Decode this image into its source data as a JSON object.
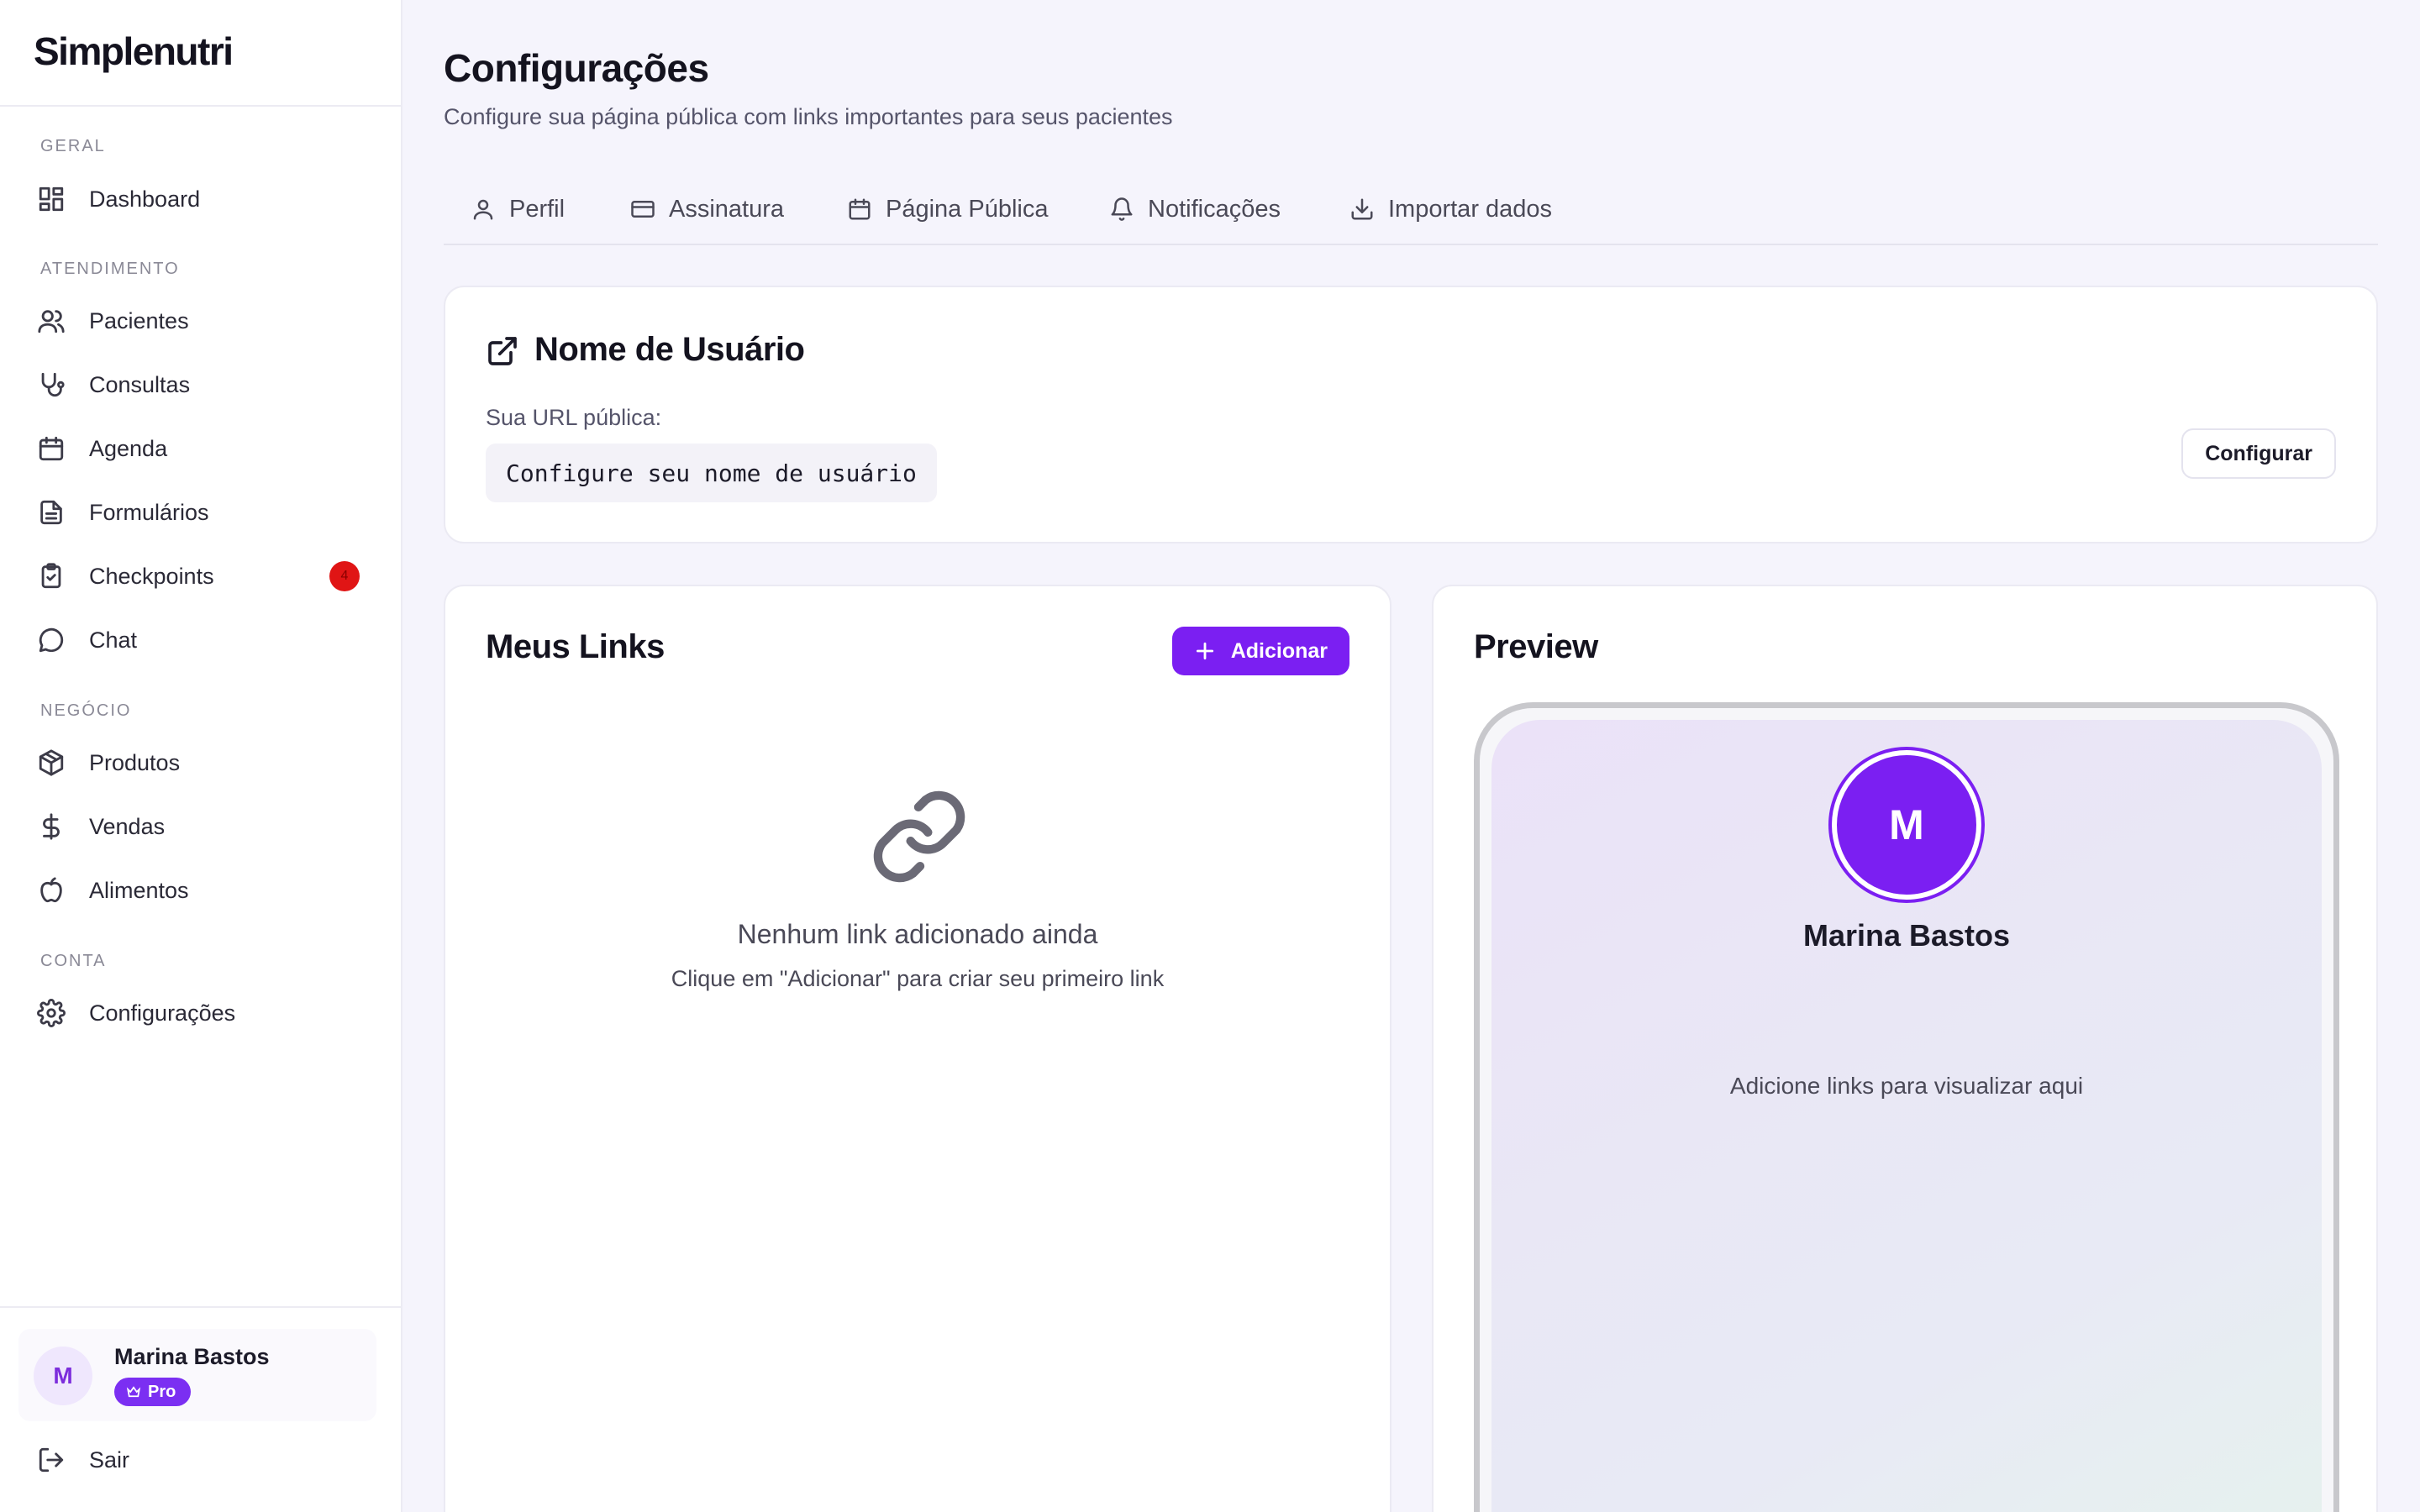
{
  "app": {
    "logo": "Simplenutri"
  },
  "sidebar": {
    "sections": {
      "geral": "GERAL",
      "atendimento": "ATENDIMENTO",
      "negocio": "NEGÓCIO",
      "conta": "CONTA"
    },
    "items": {
      "dashboard": "Dashboard",
      "pacientes": "Pacientes",
      "consultas": "Consultas",
      "agenda": "Agenda",
      "formularios": "Formulários",
      "checkpoints": "Checkpoints",
      "chat": "Chat",
      "produtos": "Produtos",
      "vendas": "Vendas",
      "alimentos": "Alimentos",
      "configuracoes": "Configurações"
    },
    "checkpoints_badge": "4",
    "user": {
      "initial": "M",
      "name": "Marina Bastos",
      "plan": "Pro"
    },
    "logout": "Sair"
  },
  "header": {
    "title": "Configurações",
    "subtitle": "Configure sua página pública com links importantes para seus pacientes"
  },
  "tabs": {
    "perfil": "Perfil",
    "assinatura": "Assinatura",
    "pagina_publica": "Página Pública",
    "notificacoes": "Notificações",
    "importar": "Importar dados"
  },
  "username_card": {
    "title": "Nome de Usuário",
    "url_label": "Sua URL pública:",
    "url_value": "Configure seu nome de usuário",
    "configure_button": "Configurar"
  },
  "links_card": {
    "title": "Meus Links",
    "add_button": "Adicionar",
    "empty_title": "Nenhum link adicionado ainda",
    "empty_hint": "Clique em \"Adicionar\" para criar seu primeiro link"
  },
  "preview_card": {
    "title": "Preview",
    "avatar_initial": "M",
    "name": "Marina Bastos",
    "empty_hint": "Adicione links para visualizar aqui"
  },
  "colors": {
    "accent": "#7b1ff2",
    "badge": "#e01515",
    "background": "#f5f4fc"
  }
}
